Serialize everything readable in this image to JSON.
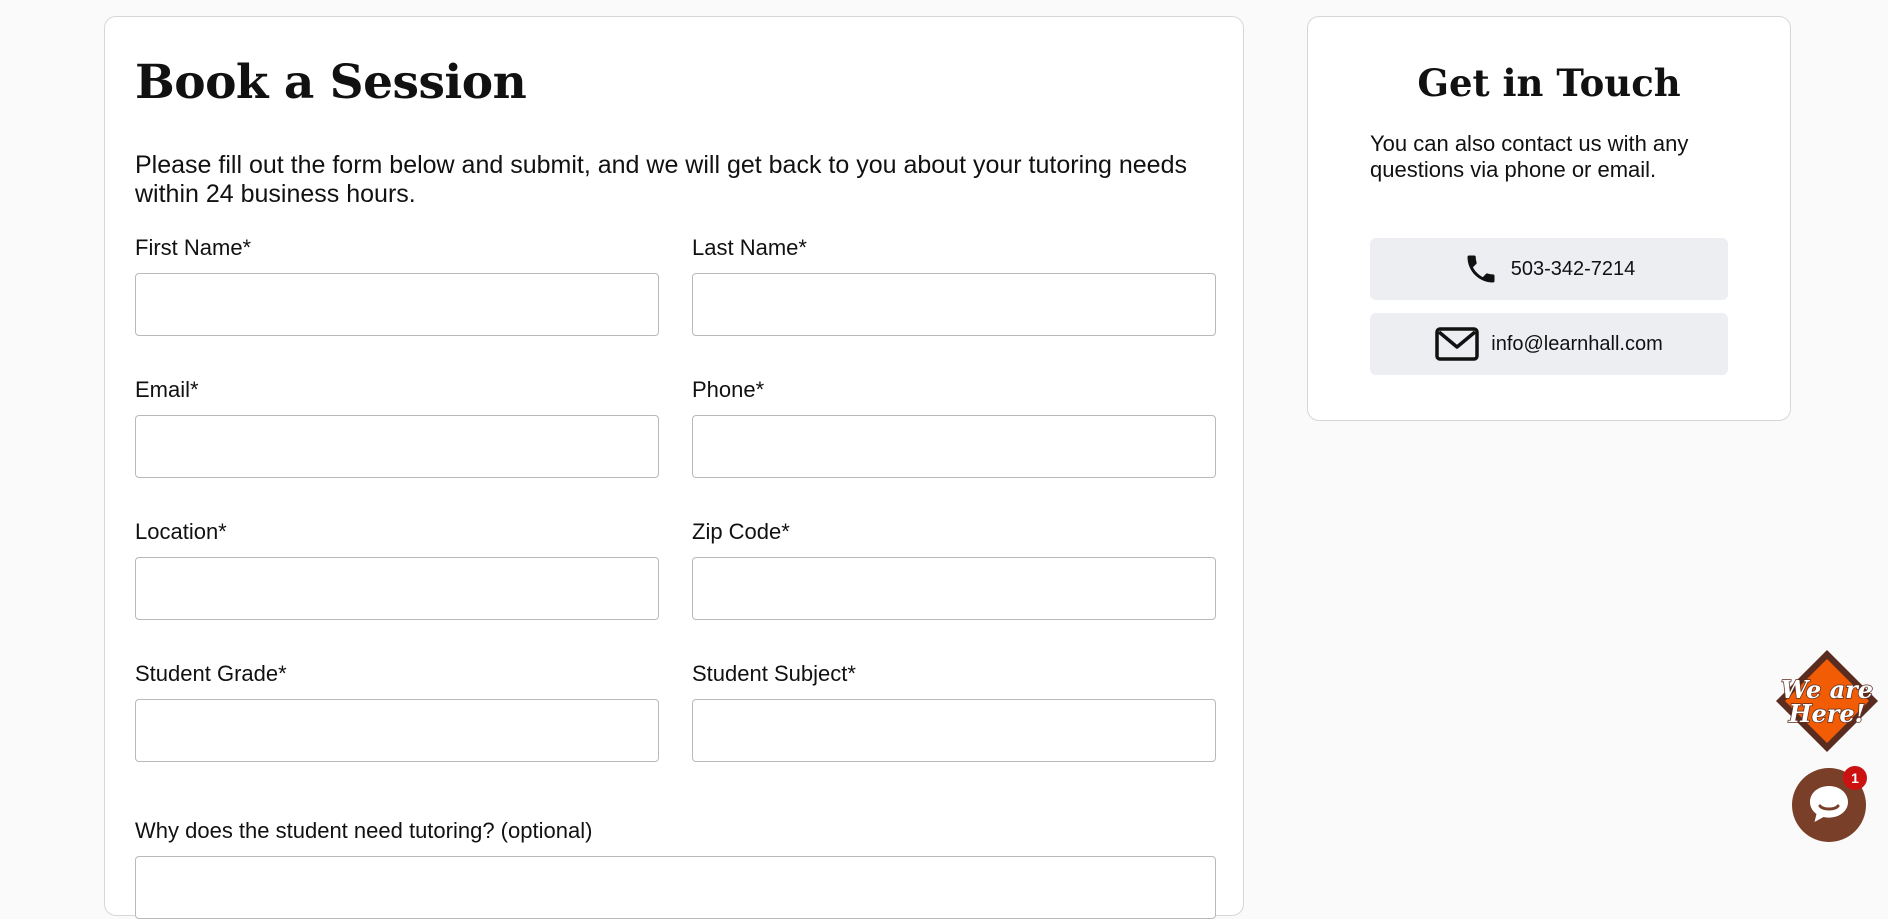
{
  "form": {
    "title": "Book a Session",
    "intro": "Please fill out the form below and submit, and we will get back to you about your tutoring needs within 24 business hours.",
    "fields": [
      {
        "label": "First Name*",
        "value": ""
      },
      {
        "label": "Last Name*",
        "value": ""
      },
      {
        "label": "Email*",
        "value": ""
      },
      {
        "label": "Phone*",
        "value": ""
      },
      {
        "label": "Location*",
        "value": ""
      },
      {
        "label": "Zip Code*",
        "value": ""
      },
      {
        "label": "Student Grade*",
        "value": ""
      },
      {
        "label": "Student Subject*",
        "value": ""
      },
      {
        "label": "Why does the student need tutoring? (optional)",
        "value": ""
      }
    ]
  },
  "contact": {
    "title": "Get in Touch",
    "text": "You can also contact us with any questions via phone or email.",
    "phone": {
      "label": "503-342-7214",
      "icon": "phone-icon"
    },
    "email": {
      "label": "info@learnhall.com",
      "icon": "mail-icon"
    }
  },
  "widget": {
    "badge_text_line1": "We are",
    "badge_text_line2": "Here!",
    "chat_icon": "chat-bubble-icon",
    "unread_count": "1"
  },
  "colors": {
    "page_background": "#fafafa",
    "card_border": "#d7d7d7",
    "contact_button_bg": "#eceef2",
    "badge_orange": "#f25c05",
    "badge_dark": "#5a2c1f",
    "chat_brown": "#7a3f28",
    "notification_red": "#cc1111"
  }
}
